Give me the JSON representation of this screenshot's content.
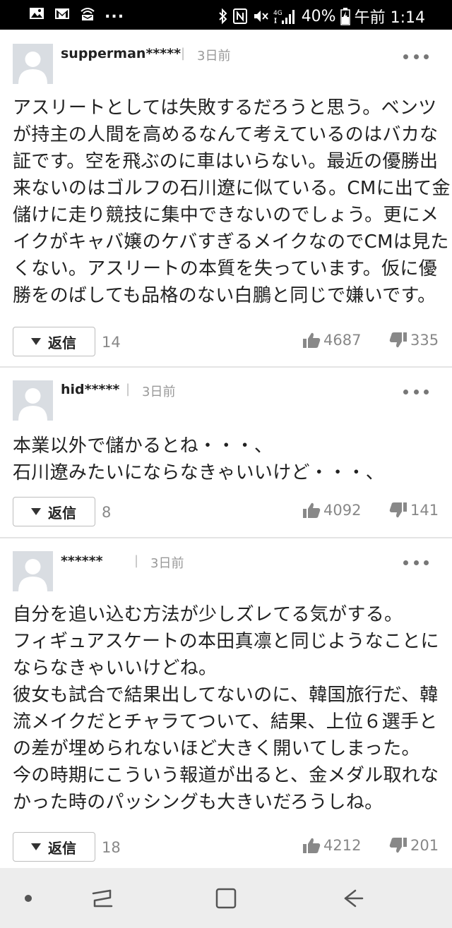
{
  "status_bar": {
    "left_icons": [
      "image-icon",
      "gmail-icon",
      "cast-icon"
    ],
    "more": "...",
    "network": "4G",
    "battery": "40%",
    "time": "午前 1:14"
  },
  "comments": [
    {
      "username": "supperman*****",
      "separator": "|",
      "date": "3日前",
      "lines": [
        "アスリートとしては失敗するだろうと思う。ベンツ",
        "が持主の人間を高めるなんて考えているのはバカな",
        "証です。空を飛ぶのに車はいらない。最近の優勝出",
        "来ないのはゴルフの石川遼に似ている。CMに出て金",
        "儲けに走り競技に集中できないのでしょう。更にメ",
        "イクがキャバ嬢のケバすぎるメイクなのでCMは見た",
        "くない。アスリートの本質を失っています。仮に優",
        "勝をのばしても品格のない白鵬と同じで嫌いです。"
      ],
      "reply_label": "返信",
      "reply_count": "14",
      "likes": "4687",
      "dislikes": "335"
    },
    {
      "username": "hid*****",
      "separator": "|",
      "date": "3日前",
      "lines": [
        "本業以外で儲かるとね・・・、",
        "石川遼みたいにならなきゃいいけど・・・、"
      ],
      "reply_label": "返信",
      "reply_count": "8",
      "likes": "4092",
      "dislikes": "141"
    },
    {
      "username": "******",
      "separator": "|",
      "date": "3日前",
      "lines": [
        "自分を追い込む方法が少しズレてる気がする。",
        "フィギュアスケートの本田真凛と同じようなことに",
        "ならなきゃいいけどね。",
        "彼女も試合で結果出してないのに、韓国旅行だ、韓",
        "流メイクだとチャラてついて、結果、上位６選手と",
        "の差が埋められないほど大きく開いてしまった。",
        "今の時期にこういう報道が出ると、金メダル取れな",
        "かった時のパッシングも大きいだろうしね。"
      ],
      "reply_label": "返信",
      "reply_count": "18",
      "likes": "4212",
      "dislikes": "201"
    }
  ],
  "nav_bar": {
    "items": [
      "dot-icon",
      "recent-apps-icon",
      "home-icon",
      "back-icon"
    ]
  }
}
